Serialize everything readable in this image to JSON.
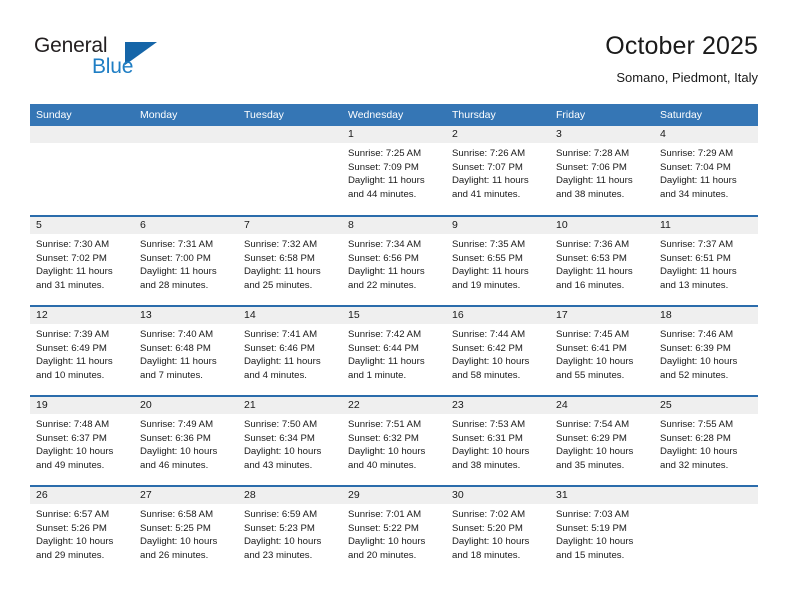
{
  "brand": {
    "name_part1": "General",
    "name_part2": "Blue",
    "mark_icon": "triangle-logo-icon"
  },
  "header": {
    "title": "October 2025",
    "subtitle": "Somano, Piedmont, Italy"
  },
  "calendar": {
    "weekday_headers": [
      "Sunday",
      "Monday",
      "Tuesday",
      "Wednesday",
      "Thursday",
      "Friday",
      "Saturday"
    ],
    "colors": {
      "header_blue": "#3576b5",
      "row_divider_blue": "#2b6cab",
      "daynum_band_gray": "#efefef",
      "brand_blue": "#1f7ec4",
      "brand_mark_blue": "#1565a8"
    },
    "weeks": [
      [
        {
          "blank": true
        },
        {
          "blank": true
        },
        {
          "blank": true
        },
        {
          "day": "1",
          "sunrise": "Sunrise: 7:25 AM",
          "sunset": "Sunset: 7:09 PM",
          "daylight_line1": "Daylight: 11 hours",
          "daylight_line2": "and 44 minutes."
        },
        {
          "day": "2",
          "sunrise": "Sunrise: 7:26 AM",
          "sunset": "Sunset: 7:07 PM",
          "daylight_line1": "Daylight: 11 hours",
          "daylight_line2": "and 41 minutes."
        },
        {
          "day": "3",
          "sunrise": "Sunrise: 7:28 AM",
          "sunset": "Sunset: 7:06 PM",
          "daylight_line1": "Daylight: 11 hours",
          "daylight_line2": "and 38 minutes."
        },
        {
          "day": "4",
          "sunrise": "Sunrise: 7:29 AM",
          "sunset": "Sunset: 7:04 PM",
          "daylight_line1": "Daylight: 11 hours",
          "daylight_line2": "and 34 minutes."
        }
      ],
      [
        {
          "day": "5",
          "sunrise": "Sunrise: 7:30 AM",
          "sunset": "Sunset: 7:02 PM",
          "daylight_line1": "Daylight: 11 hours",
          "daylight_line2": "and 31 minutes."
        },
        {
          "day": "6",
          "sunrise": "Sunrise: 7:31 AM",
          "sunset": "Sunset: 7:00 PM",
          "daylight_line1": "Daylight: 11 hours",
          "daylight_line2": "and 28 minutes."
        },
        {
          "day": "7",
          "sunrise": "Sunrise: 7:32 AM",
          "sunset": "Sunset: 6:58 PM",
          "daylight_line1": "Daylight: 11 hours",
          "daylight_line2": "and 25 minutes."
        },
        {
          "day": "8",
          "sunrise": "Sunrise: 7:34 AM",
          "sunset": "Sunset: 6:56 PM",
          "daylight_line1": "Daylight: 11 hours",
          "daylight_line2": "and 22 minutes."
        },
        {
          "day": "9",
          "sunrise": "Sunrise: 7:35 AM",
          "sunset": "Sunset: 6:55 PM",
          "daylight_line1": "Daylight: 11 hours",
          "daylight_line2": "and 19 minutes."
        },
        {
          "day": "10",
          "sunrise": "Sunrise: 7:36 AM",
          "sunset": "Sunset: 6:53 PM",
          "daylight_line1": "Daylight: 11 hours",
          "daylight_line2": "and 16 minutes."
        },
        {
          "day": "11",
          "sunrise": "Sunrise: 7:37 AM",
          "sunset": "Sunset: 6:51 PM",
          "daylight_line1": "Daylight: 11 hours",
          "daylight_line2": "and 13 minutes."
        }
      ],
      [
        {
          "day": "12",
          "sunrise": "Sunrise: 7:39 AM",
          "sunset": "Sunset: 6:49 PM",
          "daylight_line1": "Daylight: 11 hours",
          "daylight_line2": "and 10 minutes."
        },
        {
          "day": "13",
          "sunrise": "Sunrise: 7:40 AM",
          "sunset": "Sunset: 6:48 PM",
          "daylight_line1": "Daylight: 11 hours",
          "daylight_line2": "and 7 minutes."
        },
        {
          "day": "14",
          "sunrise": "Sunrise: 7:41 AM",
          "sunset": "Sunset: 6:46 PM",
          "daylight_line1": "Daylight: 11 hours",
          "daylight_line2": "and 4 minutes."
        },
        {
          "day": "15",
          "sunrise": "Sunrise: 7:42 AM",
          "sunset": "Sunset: 6:44 PM",
          "daylight_line1": "Daylight: 11 hours",
          "daylight_line2": "and 1 minute."
        },
        {
          "day": "16",
          "sunrise": "Sunrise: 7:44 AM",
          "sunset": "Sunset: 6:42 PM",
          "daylight_line1": "Daylight: 10 hours",
          "daylight_line2": "and 58 minutes."
        },
        {
          "day": "17",
          "sunrise": "Sunrise: 7:45 AM",
          "sunset": "Sunset: 6:41 PM",
          "daylight_line1": "Daylight: 10 hours",
          "daylight_line2": "and 55 minutes."
        },
        {
          "day": "18",
          "sunrise": "Sunrise: 7:46 AM",
          "sunset": "Sunset: 6:39 PM",
          "daylight_line1": "Daylight: 10 hours",
          "daylight_line2": "and 52 minutes."
        }
      ],
      [
        {
          "day": "19",
          "sunrise": "Sunrise: 7:48 AM",
          "sunset": "Sunset: 6:37 PM",
          "daylight_line1": "Daylight: 10 hours",
          "daylight_line2": "and 49 minutes."
        },
        {
          "day": "20",
          "sunrise": "Sunrise: 7:49 AM",
          "sunset": "Sunset: 6:36 PM",
          "daylight_line1": "Daylight: 10 hours",
          "daylight_line2": "and 46 minutes."
        },
        {
          "day": "21",
          "sunrise": "Sunrise: 7:50 AM",
          "sunset": "Sunset: 6:34 PM",
          "daylight_line1": "Daylight: 10 hours",
          "daylight_line2": "and 43 minutes."
        },
        {
          "day": "22",
          "sunrise": "Sunrise: 7:51 AM",
          "sunset": "Sunset: 6:32 PM",
          "daylight_line1": "Daylight: 10 hours",
          "daylight_line2": "and 40 minutes."
        },
        {
          "day": "23",
          "sunrise": "Sunrise: 7:53 AM",
          "sunset": "Sunset: 6:31 PM",
          "daylight_line1": "Daylight: 10 hours",
          "daylight_line2": "and 38 minutes."
        },
        {
          "day": "24",
          "sunrise": "Sunrise: 7:54 AM",
          "sunset": "Sunset: 6:29 PM",
          "daylight_line1": "Daylight: 10 hours",
          "daylight_line2": "and 35 minutes."
        },
        {
          "day": "25",
          "sunrise": "Sunrise: 7:55 AM",
          "sunset": "Sunset: 6:28 PM",
          "daylight_line1": "Daylight: 10 hours",
          "daylight_line2": "and 32 minutes."
        }
      ],
      [
        {
          "day": "26",
          "sunrise": "Sunrise: 6:57 AM",
          "sunset": "Sunset: 5:26 PM",
          "daylight_line1": "Daylight: 10 hours",
          "daylight_line2": "and 29 minutes."
        },
        {
          "day": "27",
          "sunrise": "Sunrise: 6:58 AM",
          "sunset": "Sunset: 5:25 PM",
          "daylight_line1": "Daylight: 10 hours",
          "daylight_line2": "and 26 minutes."
        },
        {
          "day": "28",
          "sunrise": "Sunrise: 6:59 AM",
          "sunset": "Sunset: 5:23 PM",
          "daylight_line1": "Daylight: 10 hours",
          "daylight_line2": "and 23 minutes."
        },
        {
          "day": "29",
          "sunrise": "Sunrise: 7:01 AM",
          "sunset": "Sunset: 5:22 PM",
          "daylight_line1": "Daylight: 10 hours",
          "daylight_line2": "and 20 minutes."
        },
        {
          "day": "30",
          "sunrise": "Sunrise: 7:02 AM",
          "sunset": "Sunset: 5:20 PM",
          "daylight_line1": "Daylight: 10 hours",
          "daylight_line2": "and 18 minutes."
        },
        {
          "day": "31",
          "sunrise": "Sunrise: 7:03 AM",
          "sunset": "Sunset: 5:19 PM",
          "daylight_line1": "Daylight: 10 hours",
          "daylight_line2": "and 15 minutes."
        },
        {
          "blank": true
        }
      ]
    ]
  }
}
